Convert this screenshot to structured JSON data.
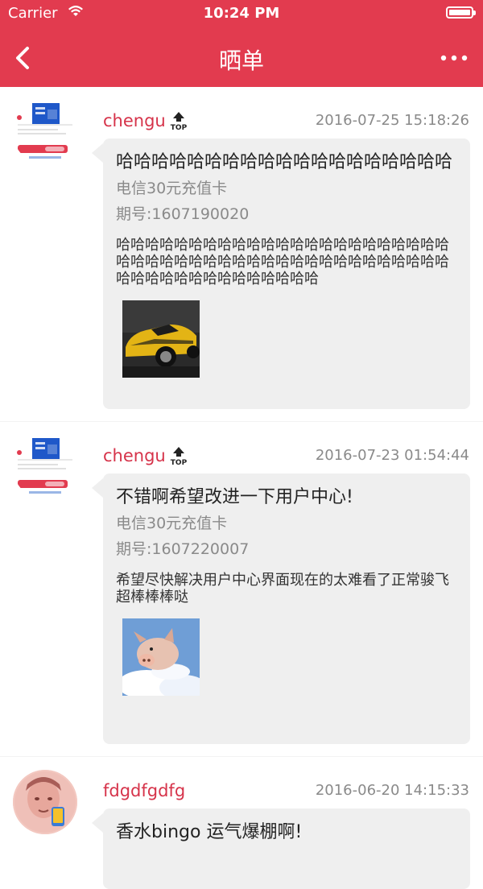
{
  "status_bar": {
    "carrier": "Carrier",
    "time": "10:24 PM"
  },
  "nav": {
    "title": "晒单"
  },
  "posts": [
    {
      "username": "chengu",
      "badge": "TOP",
      "date": "2016-07-25 15:18:26",
      "title": "哈哈哈哈哈哈哈哈哈哈哈哈哈哈哈哈哈哈哈",
      "product": "电信30元充值卡",
      "issue": "期号:1607190020",
      "body": "哈哈哈哈哈哈哈哈哈哈哈哈哈哈哈哈哈哈哈哈哈哈哈哈哈哈哈哈哈哈哈哈哈哈哈哈哈哈哈哈哈哈哈哈哈哈哈哈哈哈哈哈哈哈哈哈哈哈哈哈",
      "image_icon": "yellow-sports-car"
    },
    {
      "username": "chengu",
      "badge": "TOP",
      "date": "2016-07-23 01:54:44",
      "title": "不错啊希望改进一下用户中心!",
      "product": "电信30元充值卡",
      "issue": "期号:1607220007",
      "body": "希望尽快解决用户中心界面现在的太难看了正常骏飞超棒棒棒哒",
      "image_icon": "flying-pig"
    },
    {
      "username": "fdgdfgdfg",
      "badge": "",
      "date": "2016-06-20 14:15:33",
      "title": "香水bingo 运气爆棚啊!",
      "product": "",
      "issue": "",
      "body": "",
      "image_icon": ""
    }
  ],
  "colors": {
    "brand": "#e23b4f",
    "username": "#d6334a",
    "bubble": "#efefef"
  }
}
